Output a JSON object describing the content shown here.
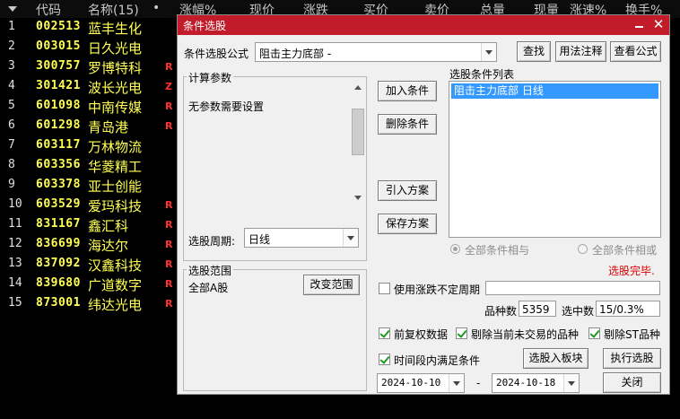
{
  "stock_list": {
    "columns": [
      "代码",
      "名称(15)",
      "•",
      "涨幅%",
      "现价",
      "涨跌",
      "买价",
      "卖价",
      "总量",
      "现量",
      "涨速%",
      "换手%"
    ],
    "rows": [
      {
        "num": "1",
        "code": "002513",
        "name": "蓝丰生化",
        "flag": ""
      },
      {
        "num": "2",
        "code": "003015",
        "name": "日久光电",
        "flag": ""
      },
      {
        "num": "3",
        "code": "300757",
        "name": "罗博特科",
        "flag": "R"
      },
      {
        "num": "4",
        "code": "301421",
        "name": "波长光电",
        "flag": "Z"
      },
      {
        "num": "5",
        "code": "601098",
        "name": "中南传媒",
        "flag": "R"
      },
      {
        "num": "6",
        "code": "601298",
        "name": "青岛港",
        "flag": "R"
      },
      {
        "num": "7",
        "code": "603117",
        "name": "万林物流",
        "flag": ""
      },
      {
        "num": "8",
        "code": "603356",
        "name": "华菱精工",
        "flag": ""
      },
      {
        "num": "9",
        "code": "603378",
        "name": "亚士创能",
        "flag": ""
      },
      {
        "num": "10",
        "code": "603529",
        "name": "爱玛科技",
        "flag": "R"
      },
      {
        "num": "11",
        "code": "831167",
        "name": "鑫汇科",
        "flag": "R"
      },
      {
        "num": "12",
        "code": "836699",
        "name": "海达尔",
        "flag": "R"
      },
      {
        "num": "13",
        "code": "837092",
        "name": "汉鑫科技",
        "flag": "R"
      },
      {
        "num": "14",
        "code": "839680",
        "name": "广道数字",
        "flag": "R"
      },
      {
        "num": "15",
        "code": "873001",
        "name": "纬达光电",
        "flag": "R"
      }
    ]
  },
  "dialog": {
    "title": "条件选股",
    "formula_label": "条件选股公式",
    "formula_value": "阻击主力底部 -",
    "find_button": "查找",
    "usage_button": "用法注释",
    "view_formula_button": "查看公式",
    "calc_params_title": "计算参数",
    "no_params_text": "无参数需要设置",
    "period_label": "选股周期:",
    "period_value": "日线",
    "add_condition_button": "加入条件",
    "delete_condition_button": "删除条件",
    "import_plan_button": "引入方案",
    "save_plan_button": "保存方案",
    "condition_list_title": "选股条件列表",
    "conditions": [
      "阻击主力底部  日线"
    ],
    "radio_and": "全部条件相与",
    "radio_or": "全部条件相或",
    "status": "选股完毕.",
    "range_title": "选股范围",
    "range_value": "全部A股",
    "change_range_button": "改变范围",
    "uncertain_period_label": "使用涨跌不定周期",
    "uncertain_period_value": "",
    "stock_count_label": "品种数",
    "stock_count_value": "5359",
    "selected_count_label": "选中数",
    "selected_count_value": "15/0.3%",
    "prev_rights_label": "前复权数据",
    "exclude_inactive_label": "剔除当前未交易的品种",
    "exclude_st_label": "剔除ST品种",
    "time_range_label": "时间段内满足条件",
    "to_board_button": "选股入板块",
    "execute_button": "执行选股",
    "date_from": "2024-10-10",
    "date_sep": "-",
    "date_to": "2024-10-18",
    "close_button": "关闭"
  }
}
